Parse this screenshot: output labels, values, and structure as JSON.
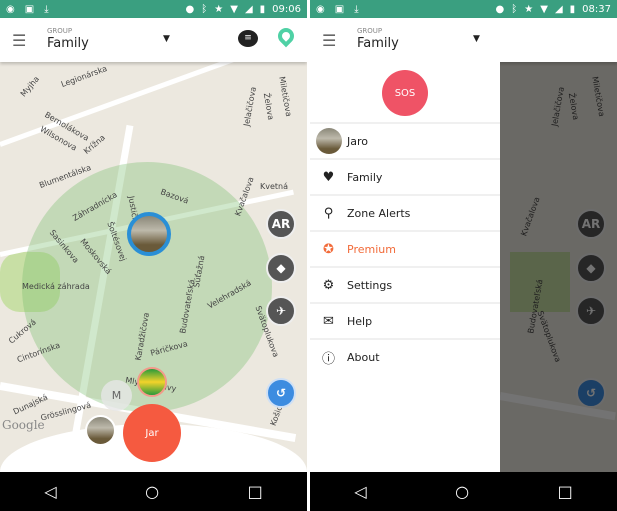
{
  "left": {
    "status": {
      "time": "09:06"
    },
    "header": {
      "group_label": "GROUP",
      "group_value": "Family"
    },
    "buttons": {
      "ar": "AR",
      "member_m": "M",
      "current_user": "Jar"
    },
    "attribution": "Google",
    "streets": [
      "Legionárska",
      "Bernolákova",
      "Wilsonova",
      "Krížna",
      "Blumentálska",
      "Záhradnícka",
      "Justičná",
      "Bazová",
      "Kvetná",
      "Kvačalova",
      "Šoltésovej",
      "Moskovská",
      "Sasinkova",
      "Medická záhrada",
      "Budovateľská",
      "Súťažná",
      "Velehradská",
      "Karadžičova",
      "Páričkova",
      "Svätoplukova",
      "Cukrová",
      "Cintorínska",
      "Dunajská",
      "Grösslingová",
      "Mlynské nivy",
      "Košická",
      "Jelačičova",
      "Želova",
      "Miletičova",
      "Myjha"
    ]
  },
  "right": {
    "status": {
      "time": "08:37"
    },
    "header": {
      "group_label": "GROUP",
      "group_value": "Family"
    },
    "buttons": {
      "ar": "AR"
    },
    "streets": [
      "Jelačičova",
      "Želova",
      "Miletičova",
      "Kvačalova",
      "Budovateľská",
      "Svätoplukova"
    ],
    "drawer": {
      "sos": "SOS",
      "items": [
        {
          "label": "Jaro",
          "icon": "avatar"
        },
        {
          "label": "Family",
          "icon": "heart-icon"
        },
        {
          "label": "Zone Alerts",
          "icon": "zone-pin-icon"
        },
        {
          "label": "Premium",
          "icon": "star-badge-icon",
          "color": "#f26b3a"
        },
        {
          "label": "Settings",
          "icon": "gears-icon"
        },
        {
          "label": "Help",
          "icon": "envelope-icon"
        },
        {
          "label": "About",
          "icon": "info-icon"
        }
      ]
    }
  },
  "colors": {
    "status_bar": "#3a9f80",
    "sos": "#ef5366",
    "user_button": "#f55a40",
    "premium": "#f26b3a",
    "history": "#3d8ce0"
  }
}
